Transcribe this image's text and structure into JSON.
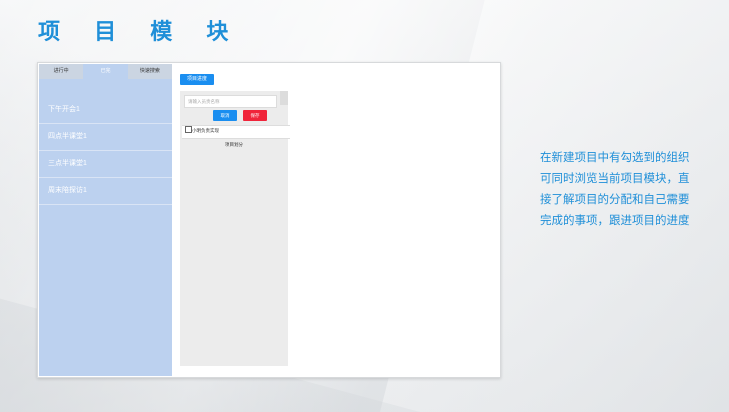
{
  "page": {
    "title": "项 目 模 块"
  },
  "app": {
    "tabs": [
      {
        "label": "进行中",
        "active": false
      },
      {
        "label": "已完",
        "active": true
      },
      {
        "label": "快速搜索",
        "active": false
      }
    ],
    "sidebar_items": [
      "下午开会1",
      "四点半课堂1",
      "三点半课堂1",
      "周末陪探访1"
    ],
    "progress_button": "项目进度",
    "search_placeholder": "请输入员责名称",
    "cancel_button": "取消",
    "save_button": "保存",
    "assignee_label": "小明负责实现",
    "project_part": "项目划分"
  },
  "description": "在新建项目中有勾选到的组织可同时浏览当前项目模块，直接了解项目的分配和自己需要完成的事项，跟进项目的进度",
  "colors": {
    "accent": "#1f8fd8",
    "sidebar": "#bcd1ef",
    "primary_button": "#1a8ef0",
    "danger_button": "#f0243a"
  }
}
